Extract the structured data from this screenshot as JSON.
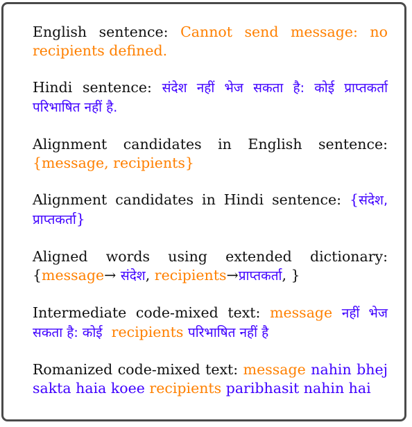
{
  "colors": {
    "english_highlight": "#FF8000",
    "hindi_highlight": "#3F00FF",
    "text": "#111111",
    "border": "#4A4A4A"
  },
  "blocks": {
    "english_sentence": {
      "label": "English sentence:",
      "value": "Cannot send message: no recipients defined."
    },
    "hindi_sentence": {
      "label": "Hindi sentence:",
      "value": "संदेश नहीं भेज सकता है: कोई प्राप्तकर्ता परिभाषित नहीं है."
    },
    "english_candidates": {
      "label": "Alignment candidates in English sentence:",
      "value": "{message, recipients}"
    },
    "hindi_candidates": {
      "label": "Alignment candidates in Hindi sentence:",
      "open": "{",
      "value": "संदेश, प्राप्तकर्ता",
      "close": "}"
    },
    "aligned_words": {
      "label": "Aligned words using extended dictionary:",
      "open": "{",
      "pairs": [
        {
          "en": "message",
          "arrow": "→",
          "hi": "संदेश",
          "sep": ","
        },
        {
          "en": "recipients",
          "arrow": "→",
          "hi": "प्राप्तकर्ता",
          "sep": ","
        }
      ],
      "close": "}"
    },
    "intermediate": {
      "label": "Intermediate code-mixed text:",
      "segments": [
        {
          "lang": "en",
          "text": "message"
        },
        {
          "lang": "hi",
          "text": "नहीं भेज सकता है: कोई"
        },
        {
          "lang": "en",
          "text": "recipients"
        },
        {
          "lang": "hi",
          "text": "परिभाषित नहीं है"
        }
      ]
    },
    "romanized": {
      "label": "Romanized code-mixed text:",
      "segments": [
        {
          "lang": "en",
          "text": "message"
        },
        {
          "lang": "hi",
          "text": "nahin bhej sakta haia koee"
        },
        {
          "lang": "en",
          "text": "recipients"
        },
        {
          "lang": "hi",
          "text": "paribhasit nahin hai"
        }
      ]
    }
  }
}
